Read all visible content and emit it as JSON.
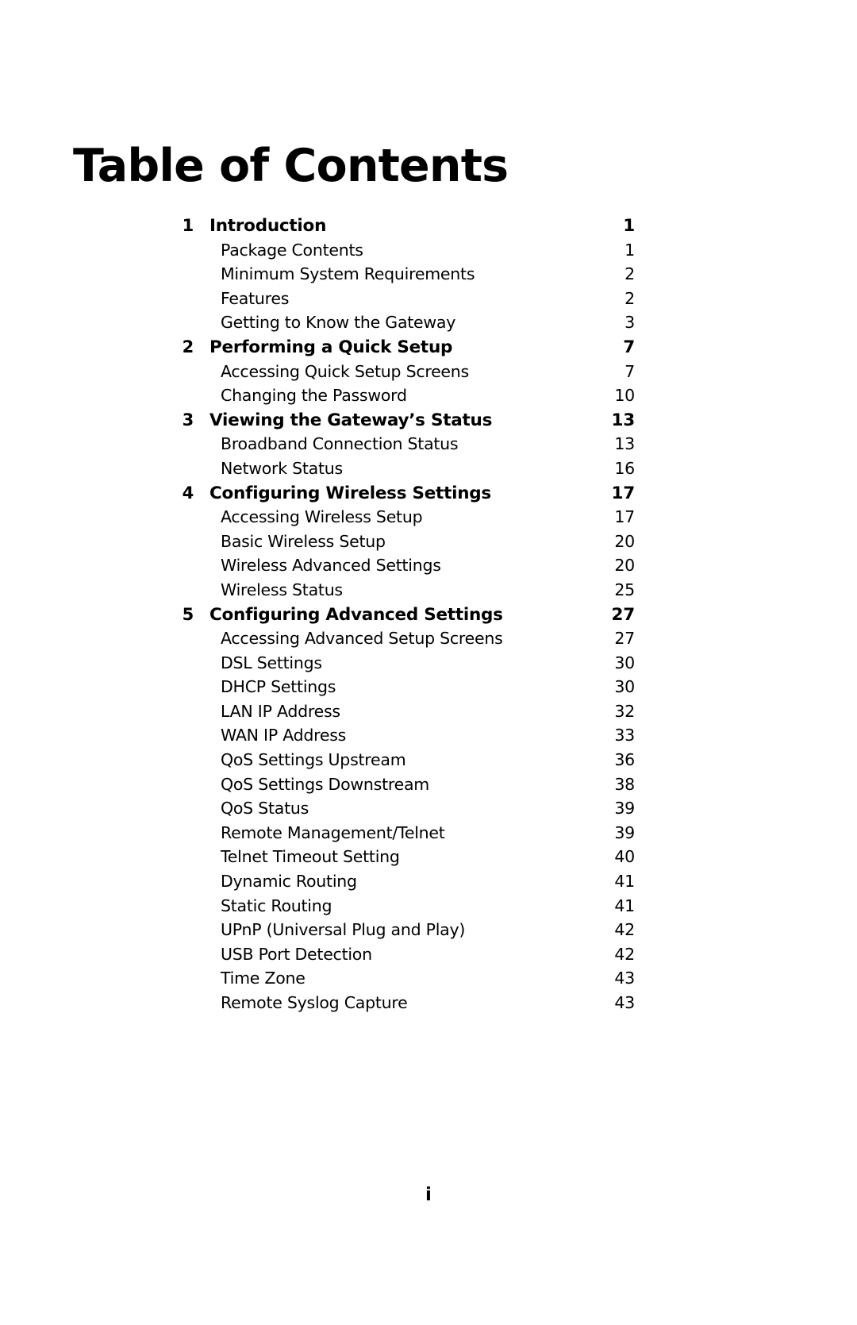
{
  "document": {
    "heading": "Table of Contents",
    "folio": "i"
  },
  "toc": {
    "entries": [
      {
        "level": "chapter",
        "number": "1",
        "label": "Introduction",
        "page": "1"
      },
      {
        "level": "section",
        "number": "",
        "label": "Package Contents",
        "page": "1"
      },
      {
        "level": "section",
        "number": "",
        "label": "Minimum System Requirements",
        "page": "2"
      },
      {
        "level": "section",
        "number": "",
        "label": "Features",
        "page": "2"
      },
      {
        "level": "section",
        "number": "",
        "label": "Getting to Know the Gateway",
        "page": "3"
      },
      {
        "level": "chapter",
        "number": "2",
        "label": "Performing a Quick Setup",
        "page": "7"
      },
      {
        "level": "section",
        "number": "",
        "label": "Accessing Quick Setup Screens",
        "page": "7"
      },
      {
        "level": "section",
        "number": "",
        "label": "Changing the Password",
        "page": "10"
      },
      {
        "level": "chapter",
        "number": "3",
        "label": "Viewing the Gateway’s Status",
        "page": "13"
      },
      {
        "level": "section",
        "number": "",
        "label": "Broadband Connection Status",
        "page": "13"
      },
      {
        "level": "section",
        "number": "",
        "label": "Network Status",
        "page": "16"
      },
      {
        "level": "chapter",
        "number": "4",
        "label": "Configuring Wireless Settings",
        "page": "17"
      },
      {
        "level": "section",
        "number": "",
        "label": "Accessing Wireless Setup",
        "page": "17"
      },
      {
        "level": "section",
        "number": "",
        "label": "Basic Wireless Setup",
        "page": "20"
      },
      {
        "level": "section",
        "number": "",
        "label": "Wireless Advanced Settings",
        "page": "20"
      },
      {
        "level": "section",
        "number": "",
        "label": "Wireless Status",
        "page": "25"
      },
      {
        "level": "chapter",
        "number": "5",
        "label": "Configuring Advanced Settings",
        "page": "27"
      },
      {
        "level": "section",
        "number": "",
        "label": "Accessing Advanced Setup Screens",
        "page": "27"
      },
      {
        "level": "section",
        "number": "",
        "label": "DSL Settings",
        "page": "30"
      },
      {
        "level": "section",
        "number": "",
        "label": "DHCP Settings",
        "page": "30"
      },
      {
        "level": "section",
        "number": "",
        "label": "LAN IP Address",
        "page": "32"
      },
      {
        "level": "section",
        "number": "",
        "label": "WAN IP Address",
        "page": "33"
      },
      {
        "level": "section",
        "number": "",
        "label": "QoS Settings Upstream",
        "page": "36"
      },
      {
        "level": "section",
        "number": "",
        "label": "QoS Settings Downstream",
        "page": "38"
      },
      {
        "level": "section",
        "number": "",
        "label": "QoS Status",
        "page": "39"
      },
      {
        "level": "section",
        "number": "",
        "label": "Remote Management/Telnet",
        "page": "39"
      },
      {
        "level": "section",
        "number": "",
        "label": "Telnet Timeout Setting",
        "page": "40"
      },
      {
        "level": "section",
        "number": "",
        "label": "Dynamic Routing",
        "page": "41"
      },
      {
        "level": "section",
        "number": "",
        "label": "Static Routing",
        "page": "41"
      },
      {
        "level": "section",
        "number": "",
        "label": "UPnP (Universal Plug and Play)",
        "page": "42"
      },
      {
        "level": "section",
        "number": "",
        "label": "USB Port Detection",
        "page": "42"
      },
      {
        "level": "section",
        "number": "",
        "label": "Time Zone",
        "page": "43"
      },
      {
        "level": "section",
        "number": "",
        "label": "Remote Syslog Capture",
        "page": "43"
      }
    ]
  },
  "colors": {
    "text": "#000000",
    "background": "#ffffff"
  }
}
